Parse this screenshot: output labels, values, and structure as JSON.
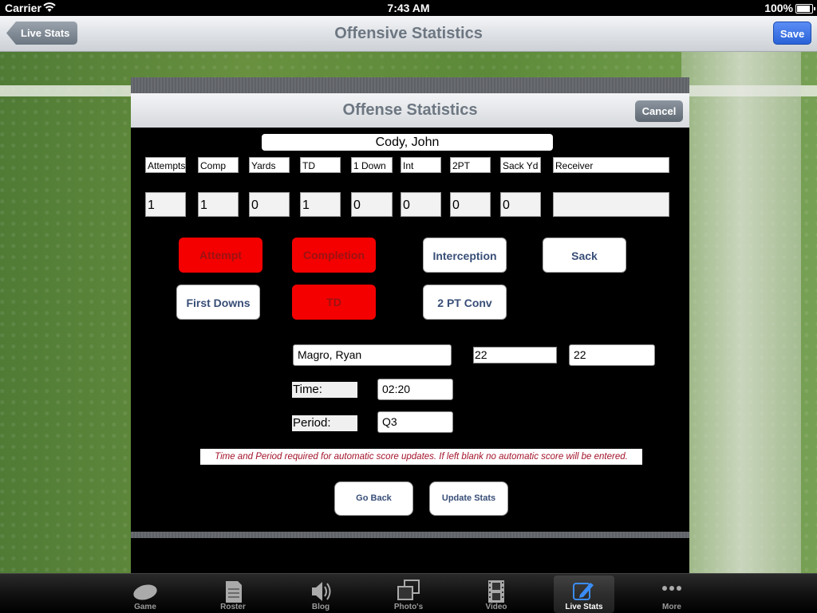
{
  "status": {
    "carrier": "Carrier",
    "time": "7:43 AM",
    "battery": "100%",
    "battery_level": 1.0
  },
  "nav": {
    "back_label": "Live Stats",
    "title": "Offensive Statistics",
    "save_label": "Save"
  },
  "dialog": {
    "title": "Offense Statistics",
    "cancel_label": "Cancel",
    "player": "Cody, John",
    "columns": [
      {
        "header": "Attempts",
        "value": "1"
      },
      {
        "header": "Comp",
        "value": "1"
      },
      {
        "header": "Yards",
        "value": "0"
      },
      {
        "header": "TD",
        "value": "1"
      },
      {
        "header": "1 Down",
        "value": "0"
      },
      {
        "header": "Int",
        "value": "0"
      },
      {
        "header": "2PT",
        "value": "0"
      },
      {
        "header": "Sack Yd",
        "value": "0"
      },
      {
        "header": "Receiver",
        "value": ""
      }
    ],
    "buttons": {
      "attempt": "Attempt",
      "completion": "Completion",
      "interception": "Interception",
      "sack": "Sack",
      "first_downs": "First Downs",
      "td": "TD",
      "two_pt_conv": "2 PT Conv"
    },
    "receiver_name": "Magro, Ryan",
    "number_1": "22",
    "number_2": "22",
    "time_label": "Time:",
    "time_value": "02:20",
    "period_label": "Period:",
    "period_value": "Q3",
    "notice": "Time and Period required for automatic score updates. If left blank no automatic score will be entered.",
    "go_back_label": "Go Back",
    "update_label": "Update Stats"
  },
  "tabs": [
    {
      "label": "Game",
      "icon": "football-icon"
    },
    {
      "label": "Roster",
      "icon": "document-icon"
    },
    {
      "label": "Blog",
      "icon": "speaker-icon"
    },
    {
      "label": "Photo's",
      "icon": "photos-icon"
    },
    {
      "label": "Video",
      "icon": "film-icon"
    },
    {
      "label": "Live Stats",
      "icon": "edit-icon"
    },
    {
      "label": "More",
      "icon": "more-icon"
    }
  ],
  "colors": {
    "accent": "#2a63d8",
    "stat_active": "#f40000",
    "notice_text": "#a3132a"
  }
}
